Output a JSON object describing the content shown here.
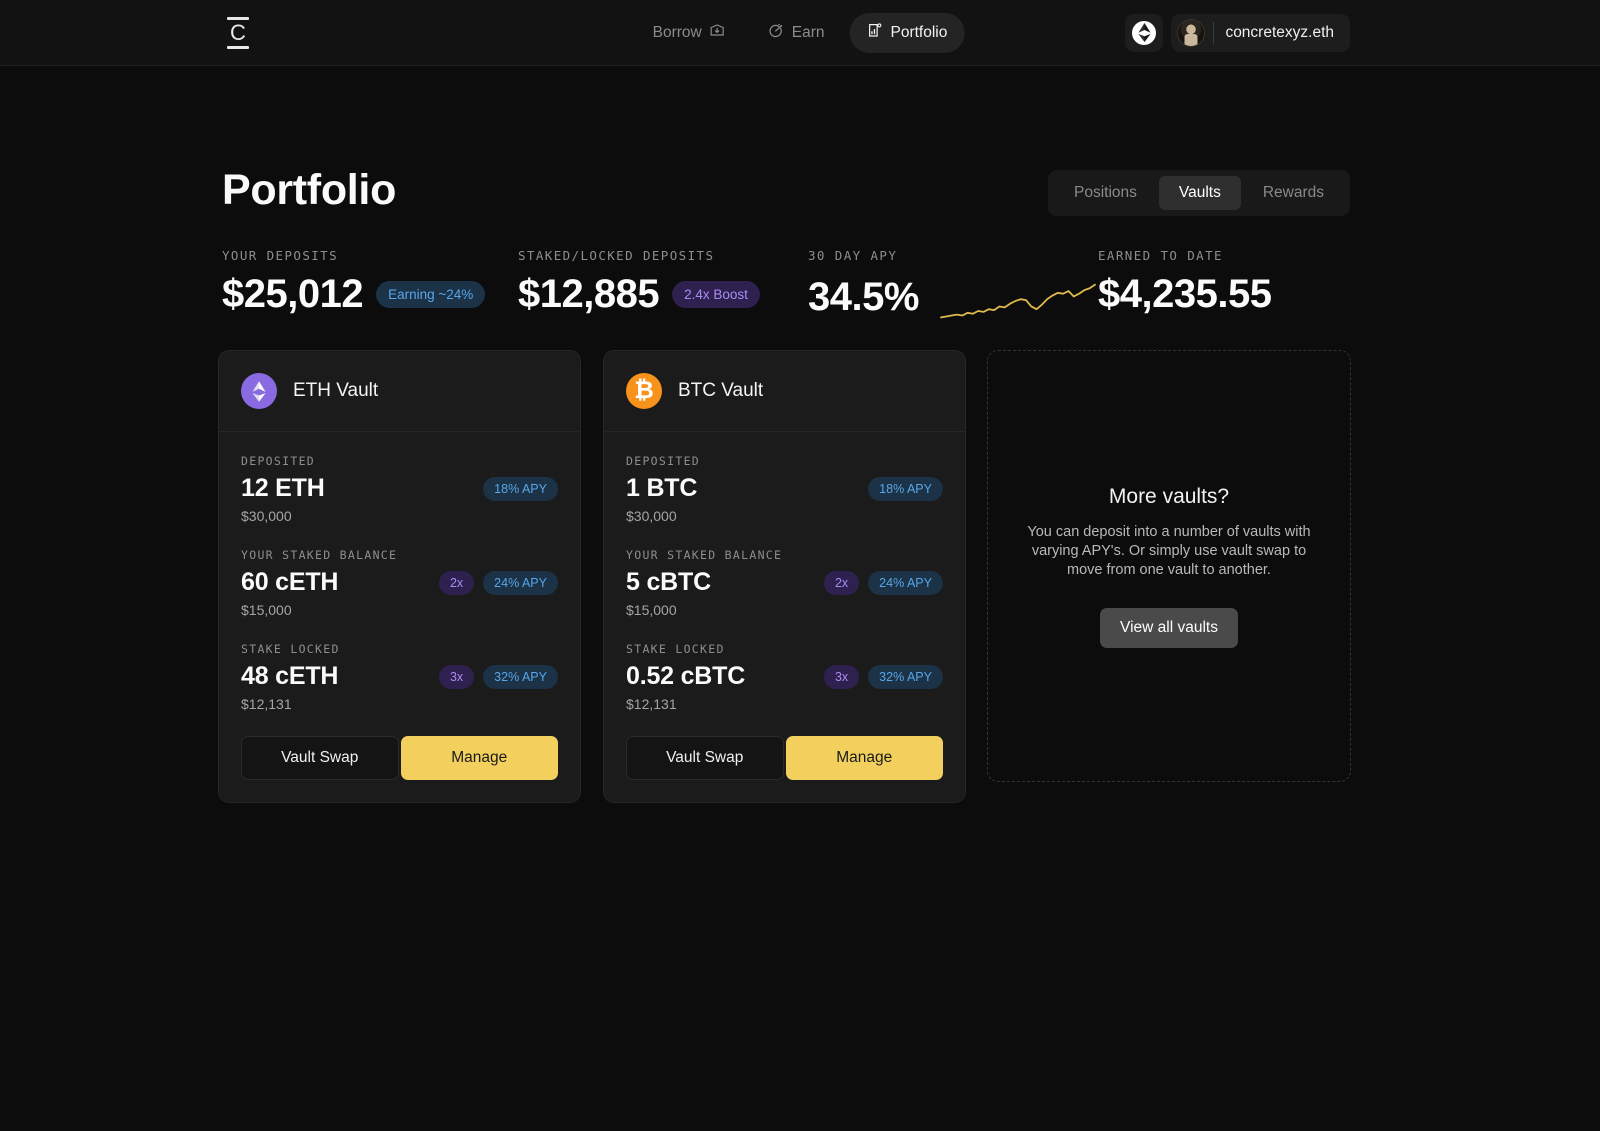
{
  "brand": {
    "logo_letter": "C",
    "logo_name": "concrete-logo"
  },
  "nav": {
    "items": [
      {
        "label": "Borrow",
        "icon": "borrow-icon",
        "active": false
      },
      {
        "label": "Earn",
        "icon": "earn-icon",
        "active": false
      },
      {
        "label": "Portfolio",
        "icon": "portfolio-icon",
        "active": true
      }
    ]
  },
  "header": {
    "network_icon": "ethereum-icon",
    "wallet_name": "concretexyz.eth",
    "avatar_icon": "avatar-icon"
  },
  "page": {
    "title": "Portfolio"
  },
  "tabs": {
    "items": [
      {
        "label": "Positions",
        "active": false
      },
      {
        "label": "Vaults",
        "active": true
      },
      {
        "label": "Rewards",
        "active": false
      }
    ]
  },
  "stats": [
    {
      "label": "YOUR DEPOSITS",
      "value": "$25,012",
      "badge": "Earning ~24%",
      "badge_color": "#58a6e8"
    },
    {
      "label": "STAKED/LOCKED DEPOSITS",
      "value": "$12,885",
      "badge": "2.4x Boost",
      "badge_color": "#a98cf0"
    },
    {
      "label": "30 DAY APY",
      "value": "34.5%",
      "badge": null,
      "badge_color": null
    },
    {
      "label": "EARNED TO DATE",
      "value": "$4,235.55",
      "badge": null,
      "badge_color": null
    }
  ],
  "chart_data": {
    "type": "line",
    "title": "30 DAY APY",
    "xlabel": "",
    "ylabel": "",
    "grid": false,
    "legend": "none",
    "line_color": "#e0b94d",
    "x": [
      0,
      1,
      2,
      3,
      4,
      5,
      6,
      7,
      8,
      9,
      10,
      11,
      12,
      13,
      14,
      15,
      16,
      17,
      18,
      19,
      20,
      21,
      22,
      23,
      24,
      25,
      26,
      27,
      28,
      29
    ],
    "values": [
      4,
      5,
      6,
      7,
      6,
      9,
      8,
      11,
      10,
      13,
      12,
      16,
      15,
      19,
      22,
      24,
      23,
      16,
      13,
      18,
      24,
      28,
      31,
      30,
      33,
      27,
      30,
      34,
      36,
      40
    ],
    "ylim": [
      0,
      44
    ]
  },
  "vaults": [
    {
      "name": "ETH Vault",
      "icon": "ethereum-icon",
      "icon_color": "#8a6ae0",
      "rows": [
        {
          "label": "DEPOSITED",
          "amount": "12 ETH",
          "usd": "$30,000",
          "multiplier": null,
          "apy": "18% APY"
        },
        {
          "label": "YOUR STAKED BALANCE",
          "amount": "60 cETH",
          "usd": "$15,000",
          "multiplier": "2x",
          "apy": "24% APY"
        },
        {
          "label": "STAKE LOCKED",
          "amount": "48 cETH",
          "usd": "$12,131",
          "multiplier": "3x",
          "apy": "32% APY"
        }
      ],
      "actions": {
        "secondary": "Vault Swap",
        "primary": "Manage"
      }
    },
    {
      "name": "BTC Vault",
      "icon": "bitcoin-icon",
      "icon_color": "#f7931a",
      "rows": [
        {
          "label": "DEPOSITED",
          "amount": "1 BTC",
          "usd": "$30,000",
          "multiplier": null,
          "apy": "18% APY"
        },
        {
          "label": "YOUR STAKED BALANCE",
          "amount": "5 cBTC",
          "usd": "$15,000",
          "multiplier": "2x",
          "apy": "24% APY"
        },
        {
          "label": "STAKE LOCKED",
          "amount": "0.52 cBTC",
          "usd": "$12,131",
          "multiplier": "3x",
          "apy": "32% APY"
        }
      ],
      "actions": {
        "secondary": "Vault Swap",
        "primary": "Manage"
      }
    }
  ],
  "empty_panel": {
    "title": "More vaults?",
    "description": "You can deposit into a number of vaults with varying APY's. Or simply use vault swap to move from one vault to another.",
    "button": "View all vaults"
  }
}
